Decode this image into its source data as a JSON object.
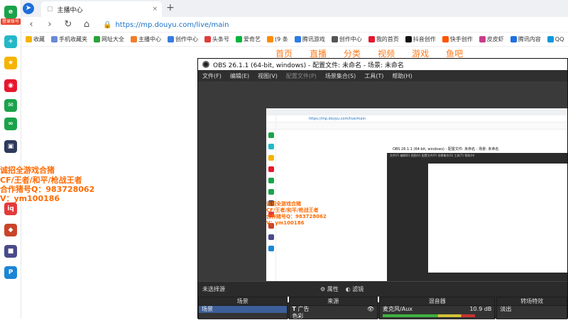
{
  "browser": {
    "tab_title": "主播中心",
    "tab_close": "×",
    "new_tab": "+",
    "url": "https://mp.douyu.com/live/main",
    "login_badge": "登录账号",
    "bookmarks": [
      {
        "label": "收藏",
        "color": "#f5b400"
      },
      {
        "label": "手机收藏夹",
        "color": "#6b8ad6"
      },
      {
        "label": "网址大全",
        "color": "#2aa33a"
      },
      {
        "label": "主播中心",
        "color": "#f07e2a"
      },
      {
        "label": "创作中心",
        "color": "#3a7be0"
      },
      {
        "label": "头条号",
        "color": "#e23b3b"
      },
      {
        "label": "爱奇艺",
        "color": "#00b53c"
      },
      {
        "label": "(9 条",
        "color": "#ff8a00"
      },
      {
        "label": "腾讯游戏",
        "color": "#2d7be6"
      },
      {
        "label": "创作中心",
        "color": "#555555"
      },
      {
        "label": "我的首页",
        "color": "#e6162d"
      },
      {
        "label": "抖音创作",
        "color": "#111111"
      },
      {
        "label": "快手创作",
        "color": "#ff5500"
      },
      {
        "label": "皮皮虾",
        "color": "#c83d8a"
      },
      {
        "label": "腾讯内容",
        "color": "#1f6fe0"
      },
      {
        "label": "QQ",
        "color": "#1296db"
      }
    ]
  },
  "sidebar_icons": [
    {
      "name": "ie-logo-icon",
      "color": "#1aa34a",
      "glyph": "e"
    },
    {
      "name": "plus-app-icon",
      "color": "#23b8c8",
      "glyph": "+"
    },
    {
      "name": "star-icon",
      "color": "#f5b400",
      "glyph": "★"
    },
    {
      "name": "weibo-icon",
      "color": "#e6162d",
      "glyph": "◉"
    },
    {
      "name": "mail-icon",
      "color": "#1aa34a",
      "glyph": "✉"
    },
    {
      "name": "cloud-icon",
      "color": "#1aa34a",
      "glyph": "∞"
    },
    {
      "name": "game-icon",
      "color": "#2e3a5c",
      "glyph": "▣"
    },
    {
      "name": "iqiyi-icon",
      "color": "#e23b3b",
      "glyph": "iq"
    },
    {
      "name": "game2-icon",
      "color": "#c8452a",
      "glyph": "◆"
    },
    {
      "name": "game3-icon",
      "color": "#4a4a8a",
      "glyph": "■"
    },
    {
      "name": "p-app-icon",
      "color": "#1a86d6",
      "glyph": "P"
    }
  ],
  "promo": {
    "line1": "诚招全游戏合猪",
    "line2": "CF/王者/和平/枪战王者",
    "line3": "合作猪号Q：983728062",
    "line4": "V：ym100186"
  },
  "douyu_nav": [
    "首页",
    "直播",
    "分类",
    "视频",
    "游戏",
    "鱼吧"
  ],
  "obs": {
    "title": "OBS 26.1.1 (64-bit, windows) - 配置文件: 未命名 - 场景: 未命名",
    "menu": [
      {
        "label": "文件(F)",
        "disabled": false
      },
      {
        "label": "编辑(E)",
        "disabled": false
      },
      {
        "label": "视图(V)",
        "disabled": false
      },
      {
        "label": "配置文件(P)",
        "disabled": true
      },
      {
        "label": "场景集合(S)",
        "disabled": false
      },
      {
        "label": "工具(T)",
        "disabled": false
      },
      {
        "label": "帮助(H)",
        "disabled": false
      }
    ],
    "no_source_selected": "未选择源",
    "properties_label": "属性",
    "filters_label": "滤镜",
    "docks": {
      "scenes_header": "场景",
      "scene_item": "场景",
      "sources_header": "来源",
      "source_item_1": "广告",
      "source_item_2": "色彩",
      "mixer_header": "混音器",
      "mixer_channel": "麦克风/Aux",
      "mixer_db": "10.9 dB",
      "transitions_header": "转场特效",
      "transition_item": "淡出"
    }
  },
  "nested": {
    "url": "https://mp.douyu.com/live/main",
    "obs_title": "OBS 26.1.1 (64-bit, windows) - 配置文件: 未命名 - 场景: 未命名",
    "promo1": "诚招全游戏合猪",
    "promo2": "CF/王者/和平/枪战王者",
    "promo3": "合作猪号Q：983728062",
    "promo4": "V：ym100186"
  }
}
